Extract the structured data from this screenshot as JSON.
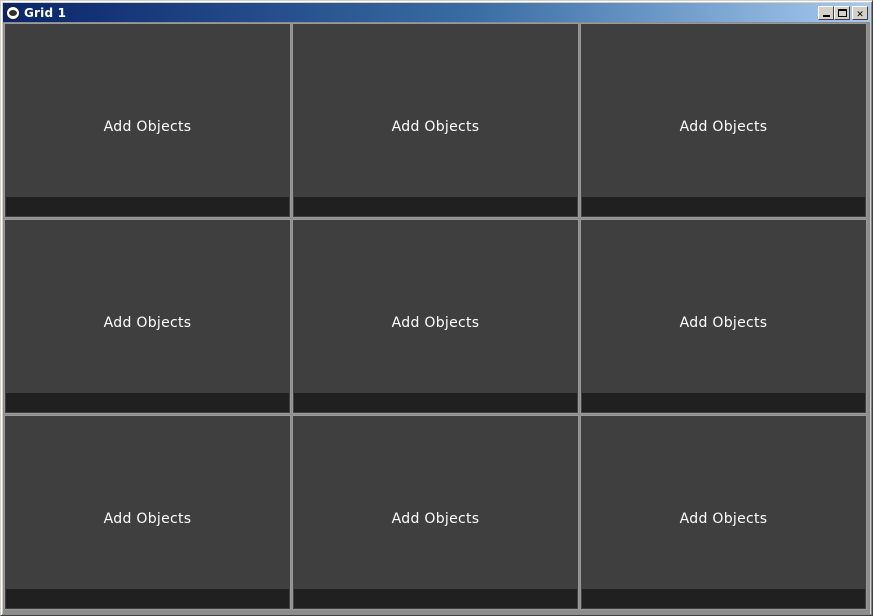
{
  "window": {
    "title": "Grid 1",
    "controls": {
      "minimize": "minimize",
      "maximize": "maximize",
      "close": "✕"
    }
  },
  "colors": {
    "title_gradient_start": "#0a246a",
    "title_gradient_end": "#a6caf0",
    "cell_background": "#3f3f3f",
    "cell_bar": "#202020",
    "grid_divider": "#8c8c8c"
  },
  "grid": {
    "rows": 3,
    "columns": 3,
    "cells": [
      {
        "label": "Add Objects"
      },
      {
        "label": "Add Objects"
      },
      {
        "label": "Add Objects"
      },
      {
        "label": "Add Objects"
      },
      {
        "label": "Add Objects"
      },
      {
        "label": "Add Objects"
      },
      {
        "label": "Add Objects"
      },
      {
        "label": "Add Objects"
      },
      {
        "label": "Add Objects"
      }
    ]
  }
}
